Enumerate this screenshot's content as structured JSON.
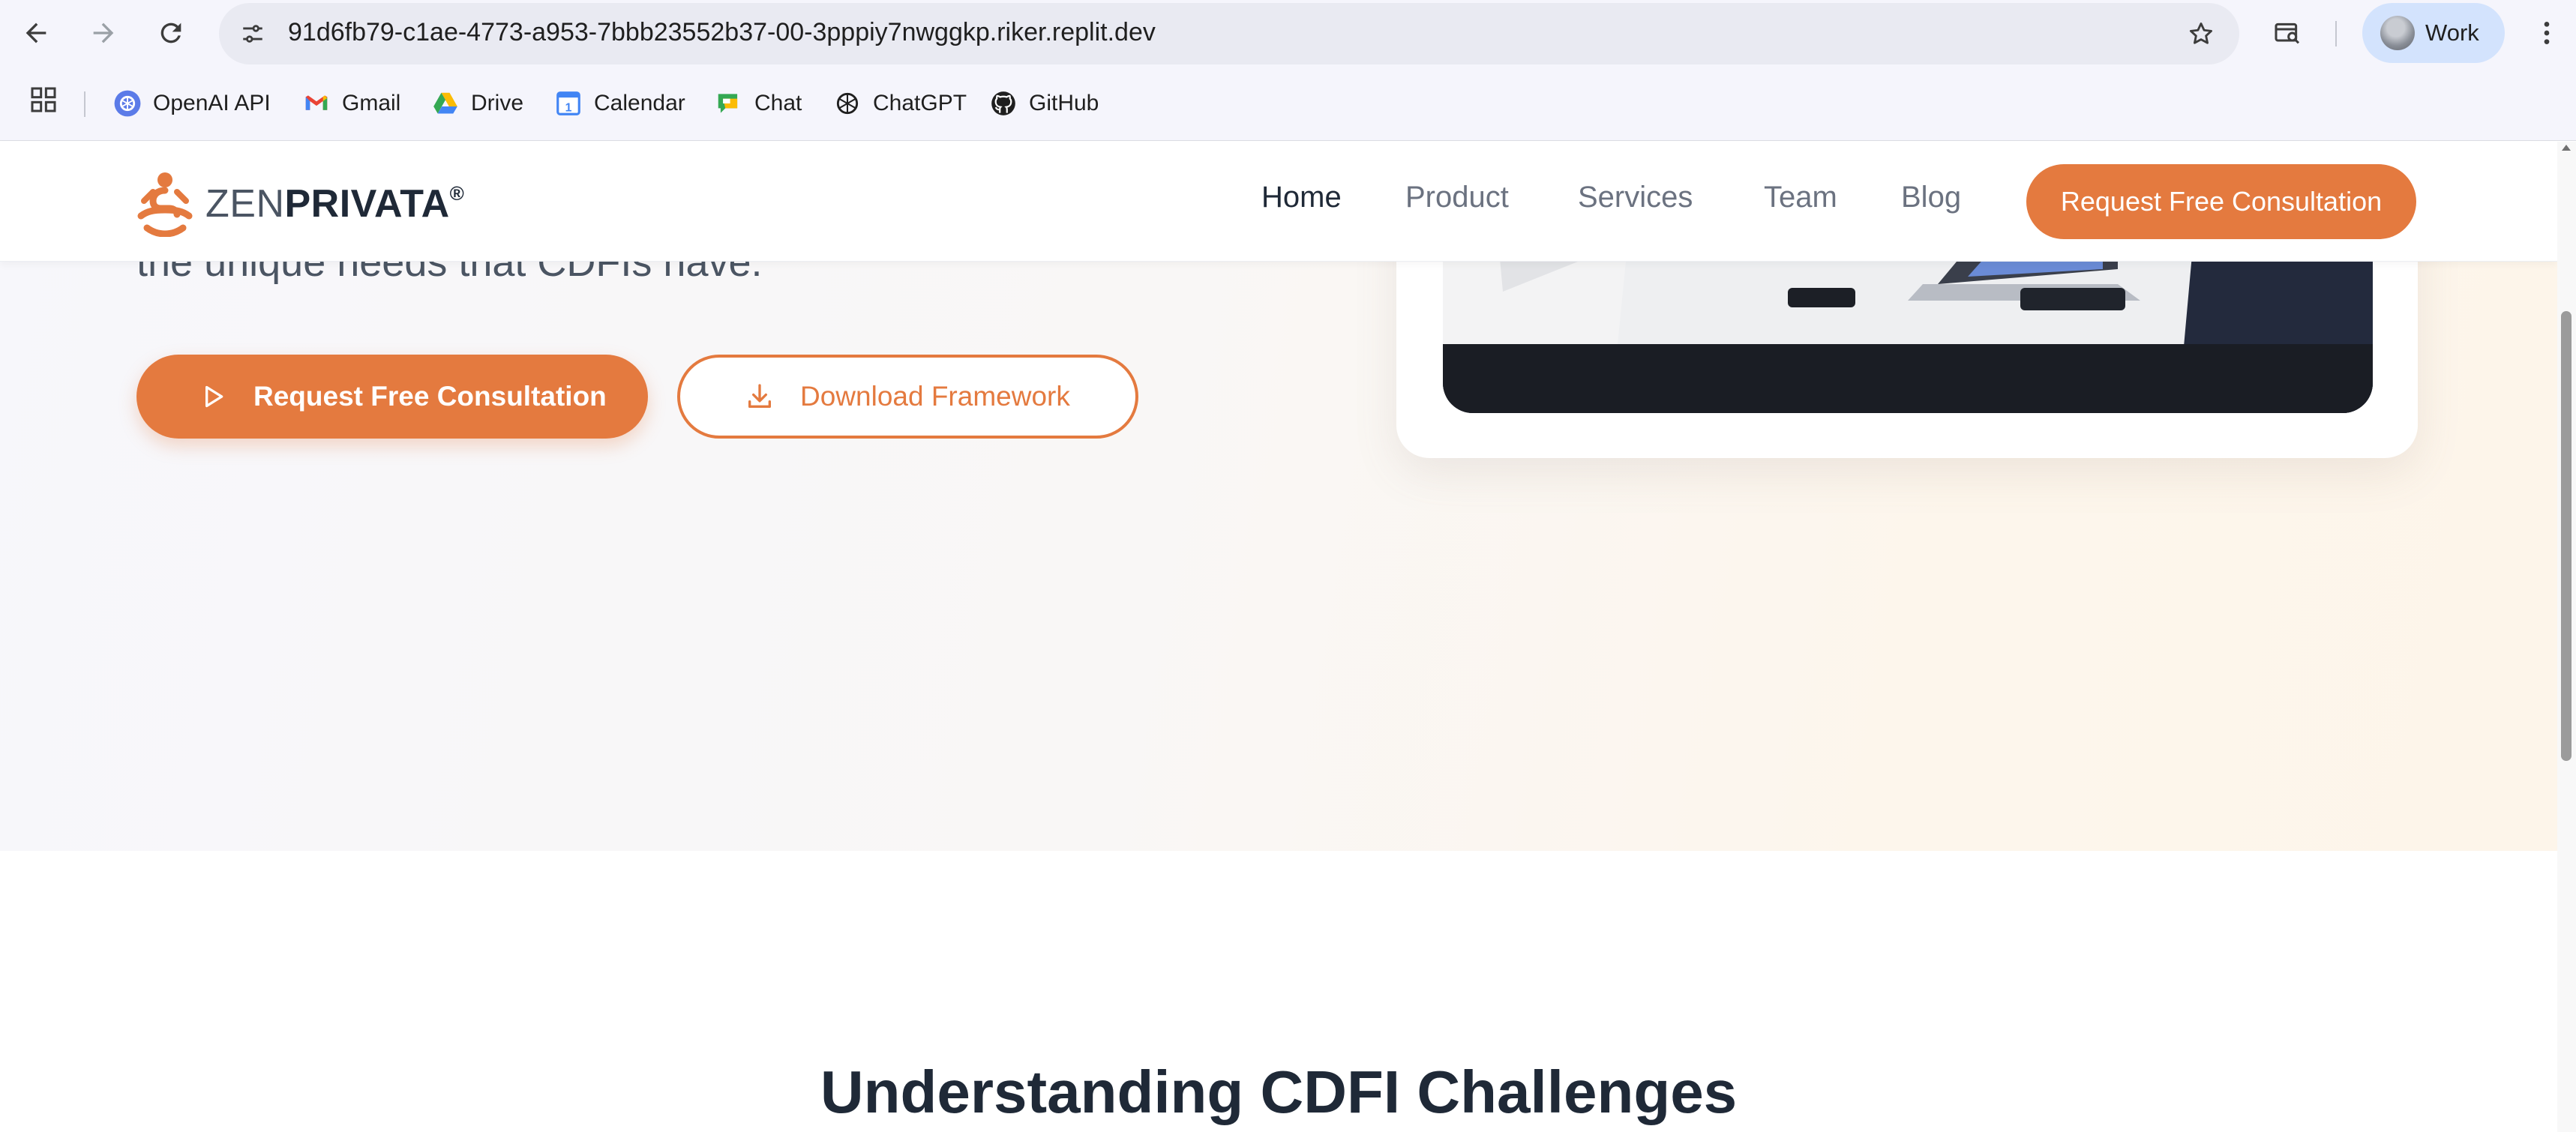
{
  "browser": {
    "url": "91d6fb79-c1ae-4773-a953-7bbb23552b37-00-3pppiy7nwggkp.riker.replit.dev",
    "profile_label": "Work",
    "bookmarks": [
      {
        "label": "OpenAI API",
        "icon": "openai-icon"
      },
      {
        "label": "Gmail",
        "icon": "gmail-icon"
      },
      {
        "label": "Drive",
        "icon": "drive-icon"
      },
      {
        "label": "Calendar",
        "icon": "calendar-icon"
      },
      {
        "label": "Chat",
        "icon": "chat-icon"
      },
      {
        "label": "ChatGPT",
        "icon": "chatgpt-icon"
      },
      {
        "label": "GitHub",
        "icon": "github-icon"
      }
    ]
  },
  "header": {
    "logo_light": "ZEN",
    "logo_bold": "PRIVATA",
    "logo_mark": "®",
    "menu": [
      {
        "label": "Home",
        "active": true
      },
      {
        "label": "Product"
      },
      {
        "label": "Services"
      },
      {
        "label": "Team"
      },
      {
        "label": "Blog"
      }
    ],
    "cta_label": "Request Free Consultation"
  },
  "hero": {
    "partial_text": "the unique needs that CDFIs have.",
    "primary_button": "Request Free Consultation",
    "secondary_button": "Download Framework"
  },
  "section": {
    "heading": "Understanding CDFI Challenges"
  },
  "colors": {
    "accent": "#e47a3f",
    "text_dark": "#1f2937",
    "text_muted": "#6b7280"
  }
}
